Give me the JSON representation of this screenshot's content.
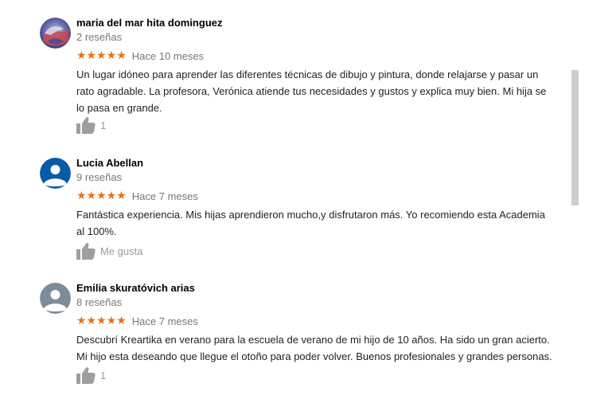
{
  "colors": {
    "star": "#e7711b",
    "muted_text": "#777777",
    "scrollbar_thumb": "#cdcdcd"
  },
  "reviews": [
    {
      "author": "maria del mar hita dominguez",
      "review_count": "2 reseñas",
      "stars": "★★★★★",
      "rating": 5,
      "time": "Hace 10 meses",
      "text": "Un lugar idóneo para aprender las diferentes técnicas de dibujo y pintura, donde relajarse y pasar un rato agradable. La profesora, Verónica atiende tus necesidades y gustos y explica muy bien. Mi hija se lo pasa en grande.",
      "like_label": "1",
      "avatar": "photo"
    },
    {
      "author": "Lucia Abellan",
      "review_count": "9 reseñas",
      "stars": "★★★★★",
      "rating": 5,
      "time": "Hace 7 meses",
      "text": "Fantástica experiencia. Mis hijas aprendieron mucho,y disfrutaron más. Yo recomiendo esta Academia al 100%.",
      "like_label": "Me gusta",
      "avatar": "default-blue"
    },
    {
      "author": "Emilia skuratóvich arias",
      "review_count": "8 reseñas",
      "stars": "★★★★★",
      "rating": 5,
      "time": "Hace 7 meses",
      "text": "Descubrí Kreartika en verano para la escuela de verano de mi hijo de 10 años. Ha sido un gran acierto. Mi hijo esta deseando que llegue el otoño para poder volver. Buenos profesionales y grandes personas.",
      "like_label": "1",
      "avatar": "default-gray"
    }
  ]
}
